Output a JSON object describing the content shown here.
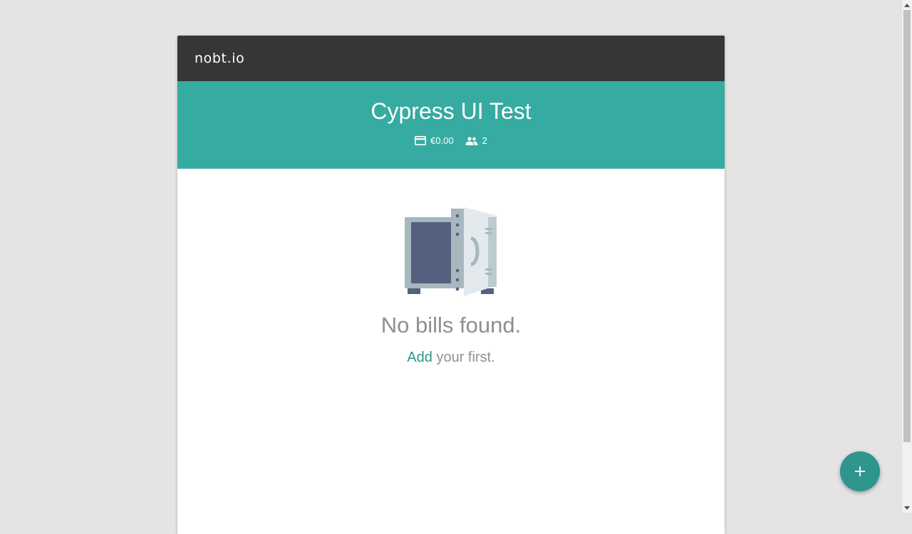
{
  "app": {
    "brand": "nobt.io"
  },
  "header": {
    "title": "Cypress UI Test",
    "total_icon": "credit-card-icon",
    "total": "€0.00",
    "members_icon": "people-icon",
    "members_count": "2",
    "color": "#36aba1"
  },
  "empty_state": {
    "illustration": "open-safe-illustration",
    "title": "No bills found.",
    "add_link": "Add",
    "rest": "your first."
  },
  "fab": {
    "icon": "plus-icon",
    "color": "#2e968c"
  },
  "colors": {
    "appbar": "#363636",
    "accent": "#2e968c",
    "background": "#e4e4e4"
  }
}
